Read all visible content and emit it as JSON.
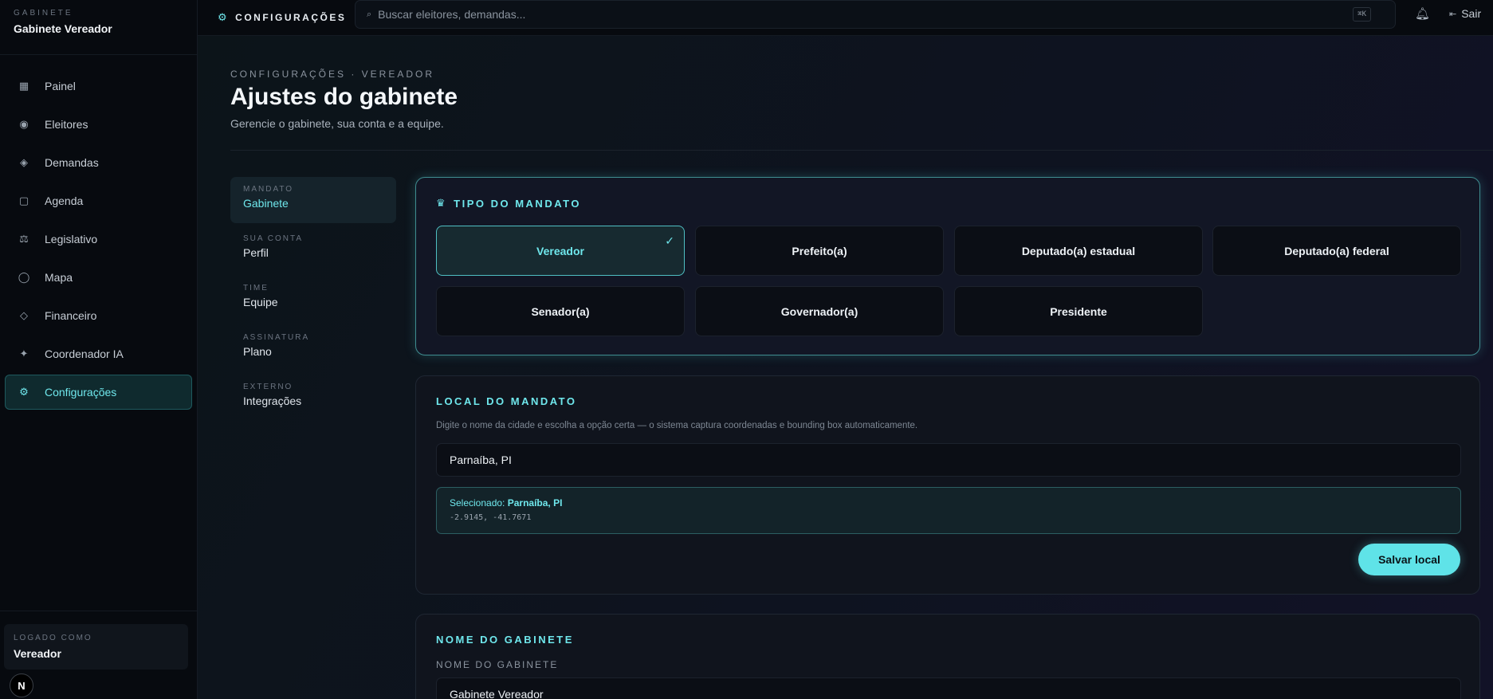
{
  "sidebar": {
    "brand_kicker": "GABINETE",
    "brand_name": "Gabinete Vereador",
    "items": [
      {
        "label": "Painel",
        "icon": "grid-icon"
      },
      {
        "label": "Eleitores",
        "icon": "target-icon"
      },
      {
        "label": "Demandas",
        "icon": "diamond-icon"
      },
      {
        "label": "Agenda",
        "icon": "square-icon"
      },
      {
        "label": "Legislativo",
        "icon": "scale-icon"
      },
      {
        "label": "Mapa",
        "icon": "circle-icon"
      },
      {
        "label": "Financeiro",
        "icon": "diamond-outline-icon"
      },
      {
        "label": "Coordenador IA",
        "icon": "sparkle-icon"
      },
      {
        "label": "Configurações",
        "icon": "gear-icon",
        "active": true
      }
    ],
    "logged_kicker": "LOGADO COMO",
    "logged_name": "Vereador",
    "badge": "N"
  },
  "topbar": {
    "title": "CONFIGURAÇÕES",
    "search_placeholder": "Buscar eleitores, demandas...",
    "shortcut": "⌘K",
    "logout": "Sair"
  },
  "header": {
    "breadcrumb": "CONFIGURAÇÕES · VEREADOR",
    "title": "Ajustes do gabinete",
    "subtitle": "Gerencie o gabinete, sua conta e a equipe."
  },
  "subnav": [
    {
      "kicker": "MANDATO",
      "label": "Gabinete",
      "active": true
    },
    {
      "kicker": "SUA CONTA",
      "label": "Perfil"
    },
    {
      "kicker": "TIME",
      "label": "Equipe"
    },
    {
      "kicker": "ASSINATURA",
      "label": "Plano"
    },
    {
      "kicker": "EXTERNO",
      "label": "Integrações"
    }
  ],
  "mandate_type": {
    "title": "TIPO DO MANDATO",
    "options": [
      "Vereador",
      "Prefeito(a)",
      "Deputado(a) estadual",
      "Deputado(a) federal",
      "Senador(a)",
      "Governador(a)",
      "Presidente"
    ],
    "selected": "Vereador"
  },
  "mandate_location": {
    "title": "LOCAL DO MANDATO",
    "helper": "Digite o nome da cidade e escolha a opção certa — o sistema captura coordenadas e bounding box automaticamente.",
    "value": "Parnaíba, PI",
    "selected_prefix": "Selecionado:",
    "selected_value": "Parnaíba, PI",
    "coords": "-2.9145, -41.7671",
    "save_label": "Salvar local"
  },
  "office_name": {
    "title": "NOME DO GABINETE",
    "field_label": "NOME DO GABINETE",
    "value": "Gabinete Vereador"
  },
  "colors": {
    "accent": "#6fe7ec",
    "background": "#0b0f16"
  }
}
